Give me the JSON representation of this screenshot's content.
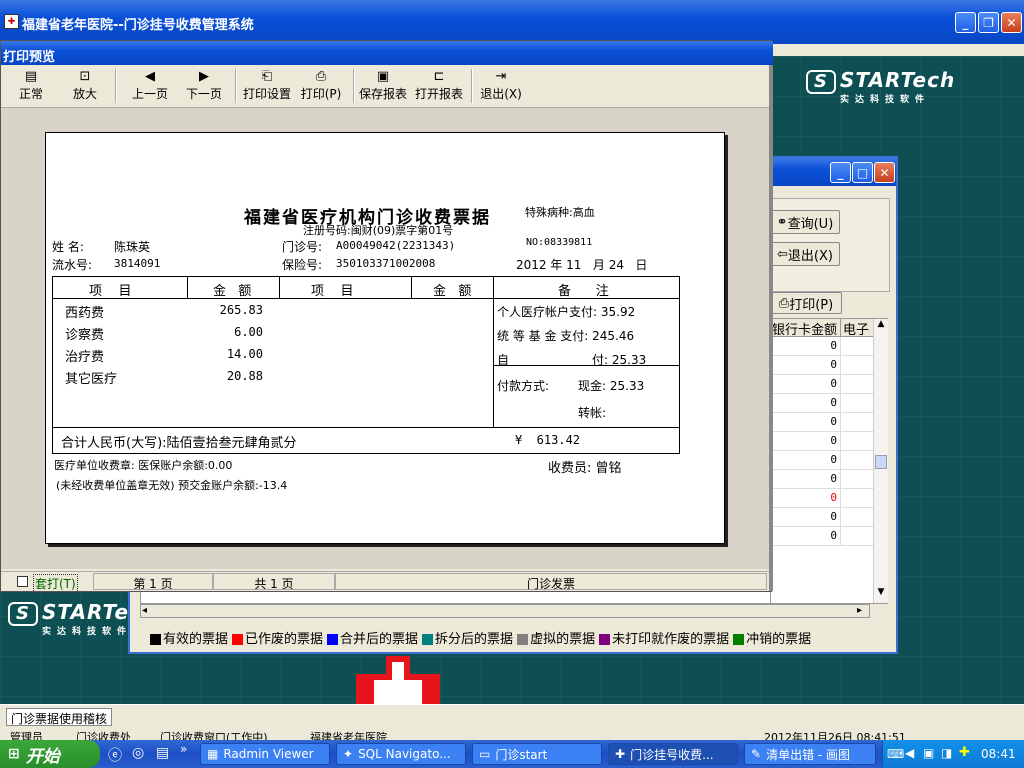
{
  "main_window": {
    "title": "福建省老年医院--门诊挂号收费管理系统"
  },
  "brand": {
    "name": "STARTech",
    "sub": "实达科技软件"
  },
  "background_window": {
    "buttons": {
      "query": "查询(U)",
      "exit": "退出(X)",
      "print": "打印(P)"
    },
    "grid_headers": [
      "银行卡金额",
      "电子"
    ],
    "grid_values": [
      "0",
      "0",
      "0",
      "0",
      "0",
      "0",
      "0",
      "0",
      "0",
      "0",
      "0"
    ],
    "legend": [
      {
        "label": "有效的票据",
        "color": "#000000"
      },
      {
        "label": "已作废的票据",
        "color": "#ff0000"
      },
      {
        "label": "合并后的票据",
        "color": "#0000ff"
      },
      {
        "label": "拆分后的票据",
        "color": "#008080"
      },
      {
        "label": "虚拟的票据",
        "color": "#808080"
      },
      {
        "label": "未打印就作废的票据",
        "color": "#800080"
      },
      {
        "label": "冲销的票据",
        "color": "#008000"
      }
    ]
  },
  "print_preview": {
    "title": "打印预览",
    "toolbar": [
      {
        "icon": "normal-icon",
        "label": "正常"
      },
      {
        "icon": "zoom-icon",
        "label": "放大"
      },
      {
        "icon": "prev-page-icon",
        "label": "上一页"
      },
      {
        "icon": "next-page-icon",
        "label": "下一页"
      },
      {
        "icon": "print-setup-icon",
        "label": "打印设置"
      },
      {
        "icon": "printer-icon",
        "label": "打印(P)"
      },
      {
        "icon": "save-icon",
        "label": "保存报表"
      },
      {
        "icon": "open-icon",
        "label": "打开报表"
      },
      {
        "icon": "exit-icon",
        "label": "退出(X)"
      }
    ],
    "status": {
      "checkbox_label": "套打(T)",
      "page": "第 1 页",
      "total": "共 1 页",
      "doc": "门诊发票"
    }
  },
  "receipt": {
    "title": "福建省医疗机构门诊收费票据",
    "special_disease": "特殊病种:高血",
    "reg_no": "注册号码:闽财(09)票字第01号",
    "no": "NO:08339811",
    "name_label": "姓  名:",
    "name": "陈珠英",
    "clinic_label": "门诊号:",
    "clinic_no": "A00049042(2231343)",
    "serial_label": "流水号:",
    "serial": "3814091",
    "insurance_label": "保险号:",
    "insurance_no": "350103371002008",
    "date": "2012 年 11   月 24   日",
    "headers": {
      "item": "项    目",
      "amount": "金   额",
      "item2": "项    目",
      "amount2": "金   额",
      "note": "备      注"
    },
    "items": [
      {
        "name": "西药费",
        "amount": "265.83"
      },
      {
        "name": "诊察费",
        "amount": "6.00"
      },
      {
        "name": "治疗费",
        "amount": "14.00"
      },
      {
        "name": "其它医疗",
        "amount": "20.88"
      }
    ],
    "notes": {
      "personal": "个人医疗帐户支付: 35.92",
      "pooled": "统 等 基 金 支付: 245.46",
      "self_label": "自",
      "self_value": "付: 25.33",
      "payment_label": "付款方式:",
      "cash": "现金: 25.33",
      "transfer": "转帐:"
    },
    "total_label": "合计人民币(大写):陆佰壹拾叁元肆角贰分",
    "total_amount": "¥  613.42",
    "unit_line": "医疗单位收费章: 医保账户余额:0.00",
    "cashier": "收费员: 曾铭",
    "warn_line": "(未经收费单位盖章无效) 预交金账户余额:-13.4"
  },
  "status_bar": {
    "text": "门诊票据使用稽核",
    "cells": [
      "管理员",
      "门诊收费处",
      "门诊收费窗口(工作中)",
      "福建省老年医院"
    ],
    "datetime": "2012年11月26日 08:41:51"
  },
  "taskbar": {
    "start": "开始",
    "tasks": [
      "Radmin Viewer",
      "SQL Navigato...",
      "门诊start",
      "门诊挂号收费...",
      "清单出错 - 画图"
    ],
    "time": "08:41"
  }
}
